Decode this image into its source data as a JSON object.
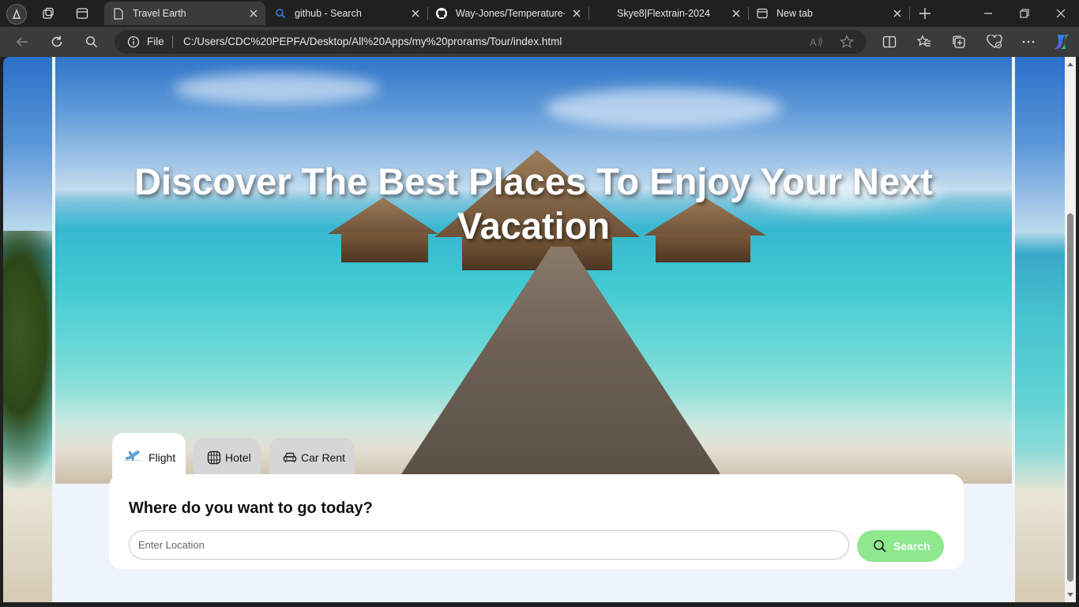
{
  "browser": {
    "tabs": [
      {
        "title": "Travel Earth",
        "icon": "page-icon",
        "active": true
      },
      {
        "title": "github - Search",
        "icon": "search-icon",
        "active": false
      },
      {
        "title": "Way-Jones/Temperature-C",
        "icon": "github-icon",
        "active": false
      },
      {
        "title": "Skye8|Flextrain-2024",
        "icon": "blank-icon",
        "active": false
      },
      {
        "title": "New tab",
        "icon": "newtab-icon",
        "active": false
      }
    ],
    "address_bar": {
      "scheme_label": "File",
      "url": "C:/Users/CDC%20PEPFA/Desktop/All%20Apps/my%20prorams/Tour/index.html"
    },
    "toolbar_icons": [
      "back-icon",
      "refresh-icon",
      "search-icon",
      "split-screen-icon",
      "favorites-icon",
      "collections-icon",
      "browser-essentials-icon",
      "more-icon",
      "copilot-icon"
    ]
  },
  "hero": {
    "title": "Discover The Best Places To Enjoy Your Next Vacation"
  },
  "search_panel": {
    "tabs": [
      {
        "label": "Flight",
        "icon": "plane-icon",
        "active": true
      },
      {
        "label": "Hotel",
        "icon": "hotel-icon",
        "active": false
      },
      {
        "label": "Car Rent",
        "icon": "car-icon",
        "active": false
      }
    ],
    "heading": "Where do you want to go today?",
    "location_placeholder": "Enter Location",
    "search_button_label": "Search"
  },
  "colors": {
    "search_button": "#8ee88e",
    "card_background": "#ffffff",
    "page_background": "#eef4fb",
    "browser_chrome": "#202020"
  }
}
